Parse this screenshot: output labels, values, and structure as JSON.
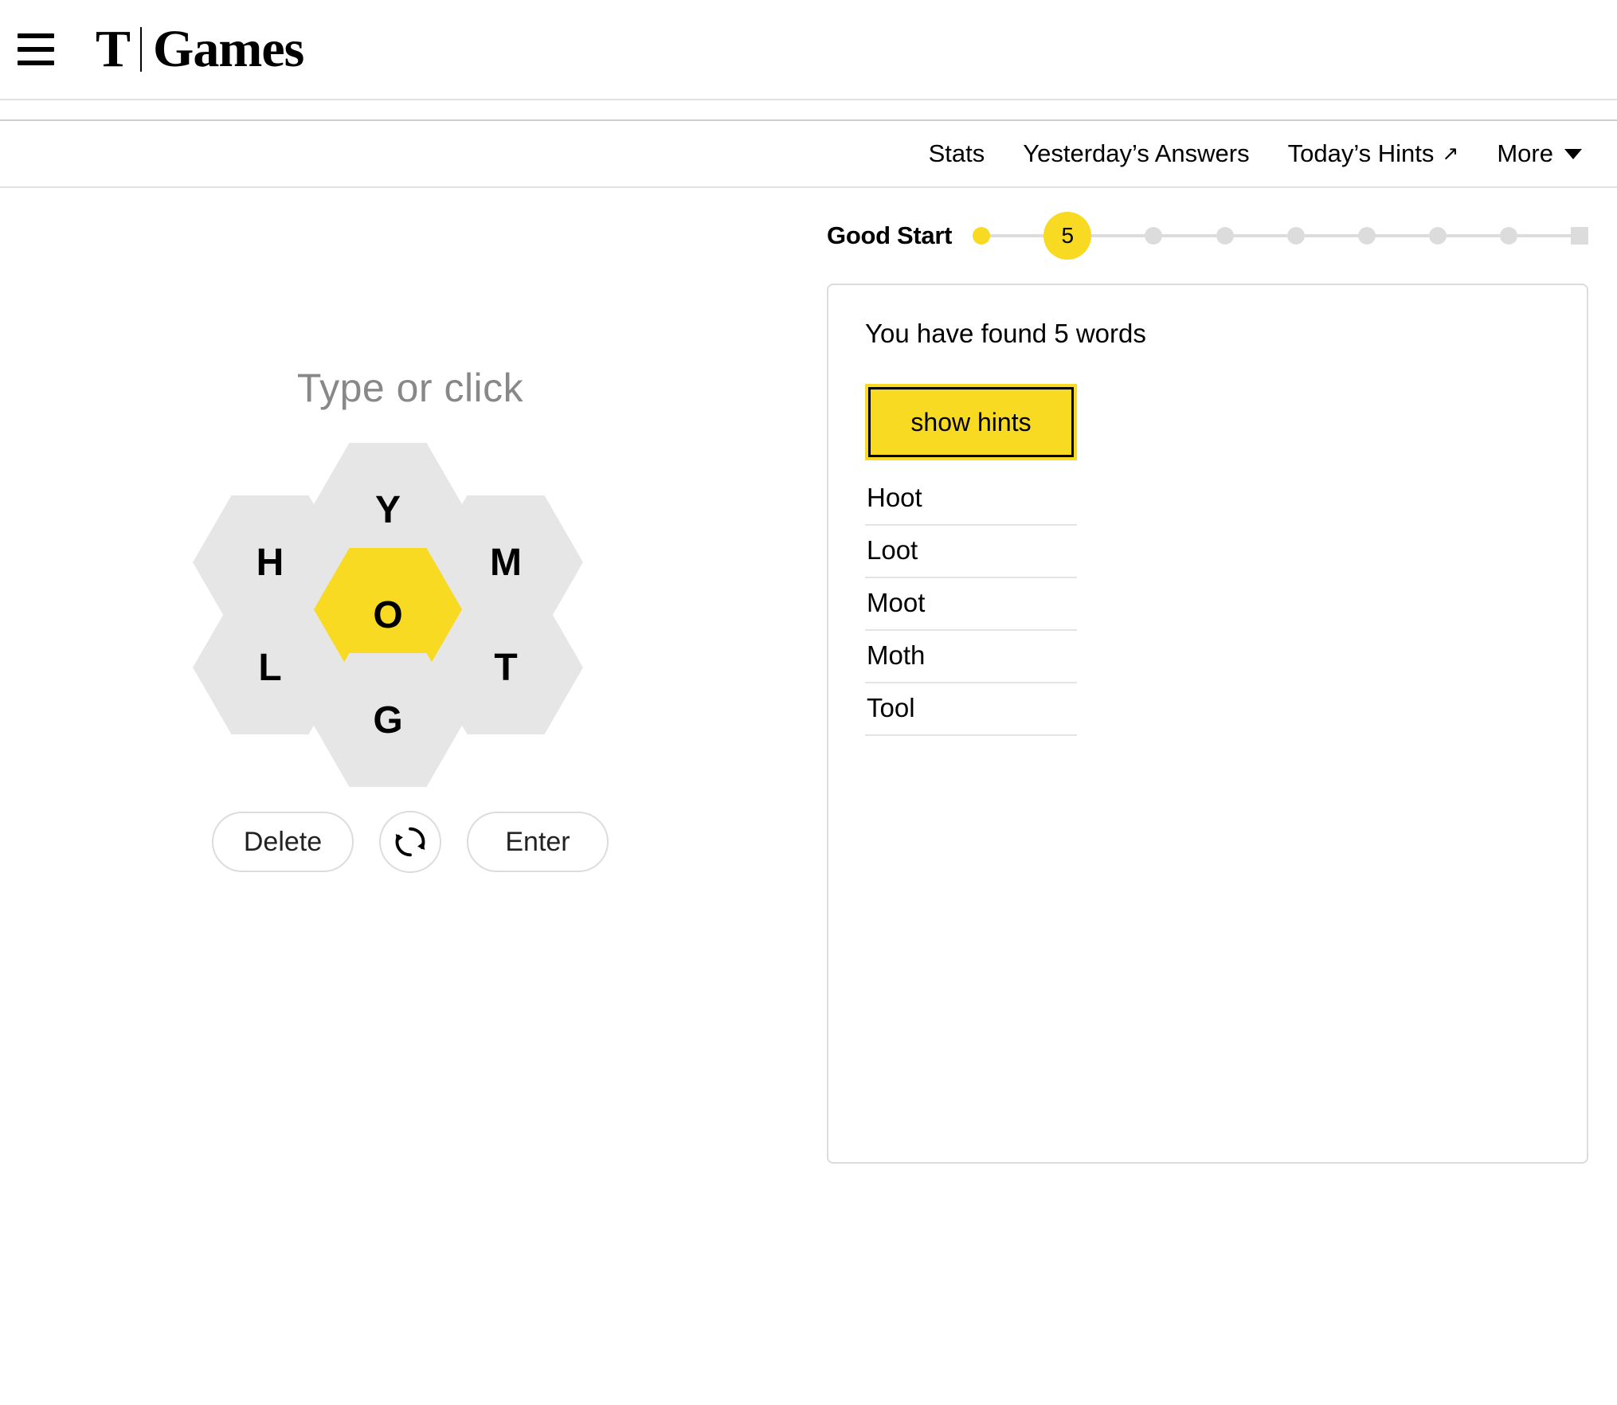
{
  "masthead": {
    "menu_icon": "hamburger-icon",
    "logo_t": "T",
    "logo_title": "Games"
  },
  "subnav": {
    "items": [
      {
        "label": "Stats",
        "icon": ""
      },
      {
        "label": "Yesterday’s Answers",
        "icon": ""
      },
      {
        "label": "Today’s Hints",
        "icon": "external-link-icon",
        "glyph": "↗"
      },
      {
        "label": "More",
        "icon": "chevron-down-icon"
      }
    ]
  },
  "puzzle": {
    "prompt": "Type or click",
    "center_letter": "O",
    "outer_letters": [
      "Y",
      "M",
      "T",
      "G",
      "L",
      "H"
    ],
    "cells": {
      "center": "O",
      "top": "Y",
      "top_right": "M",
      "bottom_right": "T",
      "bottom": "G",
      "bottom_left": "L",
      "top_left": "H"
    },
    "controls": {
      "delete_label": "Delete",
      "shuffle_icon": "shuffle-icon",
      "enter_label": "Enter"
    }
  },
  "progress": {
    "rank_label": "Good Start",
    "current_score": "5",
    "ranks_before": 1,
    "ranks_after": 6,
    "end_marker": "queen-bee-marker"
  },
  "found": {
    "count_text": "You have found 5 words",
    "hints_button_label": "show hints",
    "words": [
      "Hoot",
      "Loot",
      "Moot",
      "Moth",
      "Tool"
    ]
  },
  "colors": {
    "accent_yellow": "#f7da21",
    "cell_gray": "#e6e6e6",
    "border_gray": "#dcdcdc",
    "prompt_gray": "#888888"
  }
}
